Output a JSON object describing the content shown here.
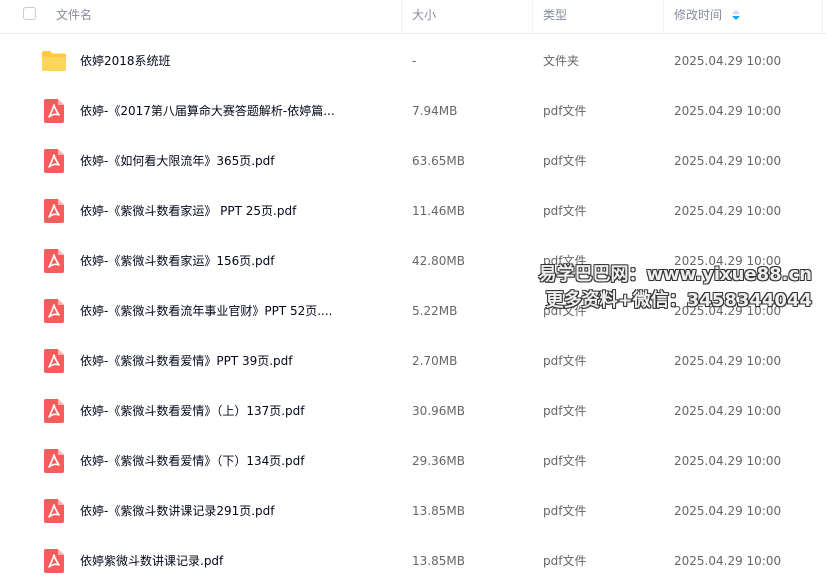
{
  "header": {
    "name_label": "文件名",
    "size_label": "大小",
    "type_label": "类型",
    "time_label": "修改时间"
  },
  "files": [
    {
      "name": "依婷2018系统班",
      "size": "-",
      "type": "文件夹",
      "time": "2025.04.29 10:00",
      "icon": "folder-icon"
    },
    {
      "name": "依婷-《2017第八届算命大赛答题解析-依婷篇...",
      "size": "7.94MB",
      "type": "pdf文件",
      "time": "2025.04.29 10:00",
      "icon": "pdf-icon"
    },
    {
      "name": "依婷-《如何看大限流年》365页.pdf",
      "size": "63.65MB",
      "type": "pdf文件",
      "time": "2025.04.29 10:00",
      "icon": "pdf-icon"
    },
    {
      "name": "依婷-《紫微斗数看家运》 PPT 25页.pdf",
      "size": "11.46MB",
      "type": "pdf文件",
      "time": "2025.04.29 10:00",
      "icon": "pdf-icon"
    },
    {
      "name": "依婷-《紫微斗数看家运》156页.pdf",
      "size": "42.80MB",
      "type": "pdf文件",
      "time": "2025.04.29 10:00",
      "icon": "pdf-icon"
    },
    {
      "name": "依婷-《紫微斗数看流年事业官财》PPT 52页....",
      "size": "5.22MB",
      "type": "pdf文件",
      "time": "2025.04.29 10:00",
      "icon": "pdf-icon"
    },
    {
      "name": "依婷-《紫微斗数看爱情》PPT 39页.pdf",
      "size": "2.70MB",
      "type": "pdf文件",
      "time": "2025.04.29 10:00",
      "icon": "pdf-icon"
    },
    {
      "name": "依婷-《紫微斗数看爱情》（上）137页.pdf",
      "size": "30.96MB",
      "type": "pdf文件",
      "time": "2025.04.29 10:00",
      "icon": "pdf-icon"
    },
    {
      "name": "依婷-《紫微斗数看爱情》（下）134页.pdf",
      "size": "29.36MB",
      "type": "pdf文件",
      "time": "2025.04.29 10:00",
      "icon": "pdf-icon"
    },
    {
      "name": "依婷-《紫微斗数讲课记录291页.pdf",
      "size": "13.85MB",
      "type": "pdf文件",
      "time": "2025.04.29 10:00",
      "icon": "pdf-icon"
    },
    {
      "name": "依婷紫微斗数讲课记录.pdf",
      "size": "13.85MB",
      "type": "pdf文件",
      "time": "2025.04.29 10:00",
      "icon": "pdf-icon"
    }
  ],
  "watermark": {
    "line1": "易学巴巴网：www.yixue88.cn",
    "line2": "更多资料+微信：3458344044"
  },
  "colors": {
    "folder": "#ffc83d",
    "pdf": "#f55d5d",
    "sort_active": "#06a7ff"
  }
}
